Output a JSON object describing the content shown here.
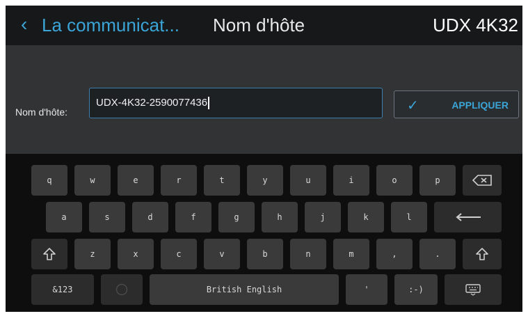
{
  "header": {
    "back_icon": "chevron-left-icon",
    "back_glyph": "‹",
    "breadcrumb": "La communicat...",
    "title": "Nom d'hôte",
    "device": "UDX 4K32"
  },
  "form": {
    "label": "Nom d'hôte:",
    "value": "UDX-4K32-2590077436",
    "apply_label": "APPLIQUER",
    "apply_icon": "check-icon",
    "apply_glyph": "✓"
  },
  "keyboard": {
    "row1": [
      "q",
      "w",
      "e",
      "r",
      "t",
      "y",
      "u",
      "i",
      "o",
      "p"
    ],
    "row2": [
      "a",
      "s",
      "d",
      "f",
      "g",
      "h",
      "j",
      "k",
      "l"
    ],
    "row3": [
      "z",
      "x",
      "c",
      "v",
      "b",
      "n",
      "m",
      ",",
      "."
    ],
    "symbols_label": "&123",
    "space_label": "British English",
    "apostrophe": "'",
    "smiley": ":-)",
    "icons": [
      "backspace-icon",
      "enter-icon",
      "shift-icon",
      "emoji-icon",
      "keyboard-hide-icon"
    ]
  },
  "colors": {
    "accent": "#3ba5d8",
    "key": "#3a3a3a",
    "keyboard_bg": "#0e0e0e",
    "panel": "#323334"
  }
}
